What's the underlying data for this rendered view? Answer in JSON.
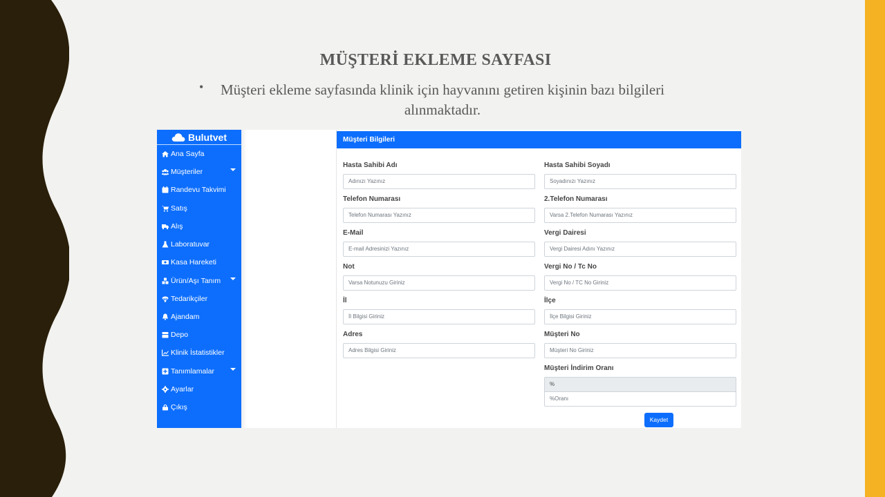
{
  "slide": {
    "title": "MÜŞTERİ EKLEME SAYFASI",
    "bullet": "Müşteri ekleme sayfasında klinik için hayvanını getiren kişinin bazı bilgileri alınmaktadır."
  },
  "app": {
    "brand": "Bulutvet",
    "sidebar": [
      {
        "label": "Ana Sayfa",
        "icon": "home-icon"
      },
      {
        "label": "Müşteriler",
        "icon": "users-icon",
        "has_submenu": true
      },
      {
        "label": "Randevu Takvimi",
        "icon": "calendar-icon"
      },
      {
        "label": "Satış",
        "icon": "cart-icon"
      },
      {
        "label": "Alış",
        "icon": "truck-icon"
      },
      {
        "label": "Laboratuvar",
        "icon": "flask-icon"
      },
      {
        "label": "Kasa Hareketi",
        "icon": "money-icon"
      },
      {
        "label": "Ürün/Aşı Tanım",
        "icon": "boxes-icon",
        "has_submenu": true
      },
      {
        "label": "Tedarikçiler",
        "icon": "parachute-icon"
      },
      {
        "label": "Ajandam",
        "icon": "bell-icon"
      },
      {
        "label": "Depo",
        "icon": "warehouse-icon"
      },
      {
        "label": "Klinik İstatistikler",
        "icon": "chart-icon"
      },
      {
        "label": "Tanımlamalar",
        "icon": "plus-square-icon",
        "has_submenu": true
      },
      {
        "label": "Ayarlar",
        "icon": "gear-icon"
      },
      {
        "label": "Çıkış",
        "icon": "lock-icon"
      }
    ],
    "form": {
      "header": "Müşteri Bilgileri",
      "fields": [
        {
          "label": "Hasta Sahibi Adı",
          "placeholder": "Adınızı Yazınız"
        },
        {
          "label": "Hasta Sahibi Soyadı",
          "placeholder": "Soyadınızı Yazınız"
        },
        {
          "label": "Telefon Numarası",
          "placeholder": "Telefon Numarası Yazınız"
        },
        {
          "label": "2.Telefon Numarası",
          "placeholder": "Varsa 2.Telefon Numarası Yazınız"
        },
        {
          "label": "E-Mail",
          "placeholder": "E-mail Adresinizi Yazınız"
        },
        {
          "label": "Vergi Dairesi",
          "placeholder": "Vergi Dairesi Adını Yazınız"
        },
        {
          "label": "Not",
          "placeholder": "Varsa Notunuzu Giriniz"
        },
        {
          "label": "Vergi No / Tc No",
          "placeholder": "Vergi No / TC No Giriniz"
        },
        {
          "label": "İl",
          "placeholder": "İl Bilgisi Giriniz"
        },
        {
          "label": "İlçe",
          "placeholder": "İlçe Bilgisi Giriniz"
        },
        {
          "label": "Adres",
          "placeholder": "Adres Bilgisi Giriniz"
        },
        {
          "label": "Müşteri No",
          "placeholder": "Müşteri No Giriniz"
        }
      ],
      "discount": {
        "label": "Müşteri İndirim Oranı",
        "addon": "%",
        "placeholder": "%Oranı"
      },
      "save_label": "Kaydet"
    }
  },
  "colors": {
    "primary": "#0d6efd",
    "accent_bar": "#f5b324",
    "deco_dark": "#2a1f0a"
  }
}
